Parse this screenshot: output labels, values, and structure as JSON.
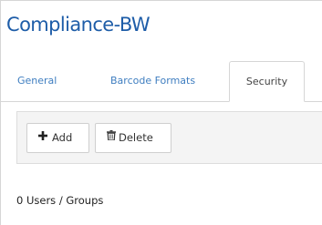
{
  "header": {
    "title": "Compliance-BW"
  },
  "tabs": [
    {
      "label": "General",
      "active": false
    },
    {
      "label": "Barcode Formats",
      "active": false
    },
    {
      "label": "Security",
      "active": true
    }
  ],
  "toolbar": {
    "add_label": "Add",
    "add_icon": "plus-icon",
    "delete_label": "Delete",
    "delete_icon": "trash-icon"
  },
  "summary": {
    "count_text": "0 Users / Groups"
  },
  "colors": {
    "title": "#1e5da8",
    "tab_link": "#3f7ec0",
    "toolbar_bg": "#f4f4f4"
  }
}
